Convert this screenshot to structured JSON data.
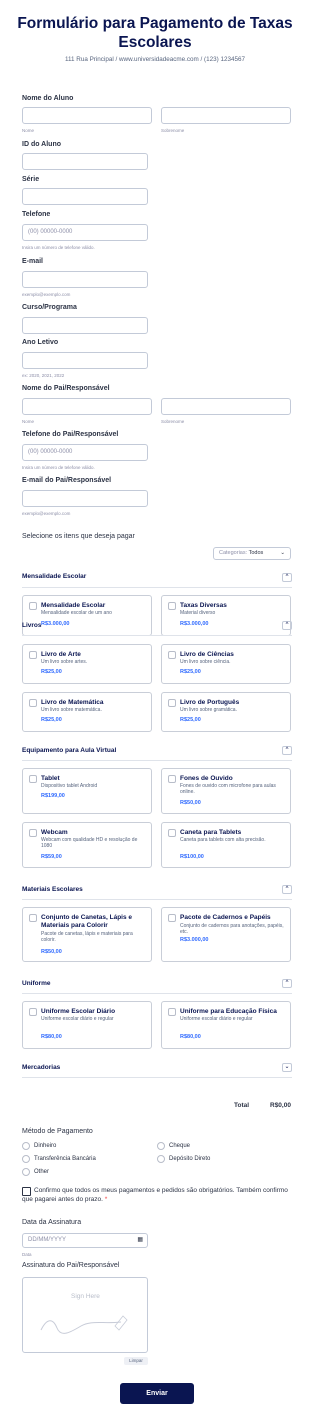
{
  "header": {
    "title": "Formulário para Pagamento de Taxas Escolares",
    "address": "111 Rua Principal / www.universidadeacme.com / (123) 1234567"
  },
  "fields": {
    "student_name": "Nome do Aluno",
    "first": "Nome",
    "last": "Sobrenome",
    "student_id": "ID do Aluno",
    "grade": "Série",
    "phone": "Telefone",
    "phone_placeholder": "(00) 00000-0000",
    "phone_hint": "Insira um número de telefone válido.",
    "email": "E-mail",
    "email_hint": "exemplo@exemplo.com",
    "course": "Curso/Programa",
    "year": "Ano Letivo",
    "year_hint": "ex: 2020, 2021, 2022",
    "parent_name": "Nome do Pai/Responsável",
    "parent_phone": "Telefone do Pai/Responsável",
    "parent_phone_placeholder": "(00) 00000-0000",
    "parent_phone_hint": "Insira um número de telefone válido.",
    "parent_email": "E-mail do Pai/Responsável",
    "parent_email_hint": "exemplo@exemplo.com"
  },
  "products": {
    "prompt": "Selecione os itens que deseja pagar",
    "filter_label": "Categorias:",
    "filter_value": "Todos",
    "categories": [
      {
        "name": "Mensalidade Escolar",
        "items": [
          {
            "name": "Mensalidade Escolar",
            "desc": "Mensalidade escolar de um ano",
            "price": "R$3.000,00"
          },
          {
            "name": "Taxas Diversas",
            "desc": "Material diverso",
            "price": "R$3.000,00"
          }
        ]
      },
      {
        "name": "Livros",
        "items": [
          {
            "name": "Livro de Arte",
            "desc": "Um livro sobre artes.",
            "price": "R$25,00"
          },
          {
            "name": "Livro de Ciências",
            "desc": "Um livro sobre ciência.",
            "price": "R$25,00"
          },
          {
            "name": "Livro de Matemática",
            "desc": "Um livro sobre matemática.",
            "price": "R$25,00"
          },
          {
            "name": "Livro de Português",
            "desc": "Um livro sobre gramática.",
            "price": "R$25,00"
          }
        ]
      },
      {
        "name": "Equipamento para Aula Virtual",
        "items": [
          {
            "name": "Tablet",
            "desc": "Dispositivo tablet Android",
            "price": "R$199,00"
          },
          {
            "name": "Fones de Ouvido",
            "desc": "Fones de ouvido com microfone para aulas online.",
            "price": "R$50,00"
          },
          {
            "name": "Webcam",
            "desc": "Webcam com qualidade HD e resolução de 1080",
            "price": "R$59,00"
          },
          {
            "name": "Caneta para Tablets",
            "desc": "Caneta para tablets com alta precisão.",
            "price": "R$100,00"
          }
        ]
      },
      {
        "name": "Materiais Escolares",
        "items": [
          {
            "name": "Conjunto de Canetas, Lápis e Materiais para Colorir",
            "desc": "Pacote de canetas, lápis e materiais para colorir.",
            "price": "R$50,00"
          },
          {
            "name": "Pacote de Cadernos e Papéis",
            "desc": "Conjunto de cadernos para anotações, papéis, etc.",
            "price": "R$3.000,00"
          }
        ]
      },
      {
        "name": "Uniforme",
        "items": [
          {
            "name": "Uniforme Escolar Diário",
            "desc": "Uniforme escolar diário e regular",
            "price": "R$80,00"
          },
          {
            "name": "Uniforme para Educação Física",
            "desc": "Uniforme escolar diário e regular",
            "price": "R$80,00"
          }
        ]
      },
      {
        "name": "Mercadorias",
        "items": []
      }
    ],
    "total_label": "Total",
    "total_value": "R$0,00"
  },
  "payment": {
    "label": "Método de Pagamento",
    "options": [
      "Dinheiro",
      "Cheque",
      "Transferência Bancária",
      "Depósito Direto",
      "Other"
    ]
  },
  "confirm": {
    "text": "Confirmo que todos os meus pagamentos e pedidos são obrigatórios. Também confirmo que pagarei antes do prazo.",
    "required": "*"
  },
  "signature": {
    "date_label": "Data da Assinatura",
    "date_placeholder": "DD/MM/YYYY",
    "date_hint": "Data",
    "sig_label": "Assinatura do Pai/Responsável",
    "sig_placeholder": "Sign Here",
    "clear": "Limpar"
  },
  "submit": "Enviar",
  "colors": {
    "navy": "#0a1551",
    "price": "#2e69ff",
    "required": "#f23a3c"
  }
}
